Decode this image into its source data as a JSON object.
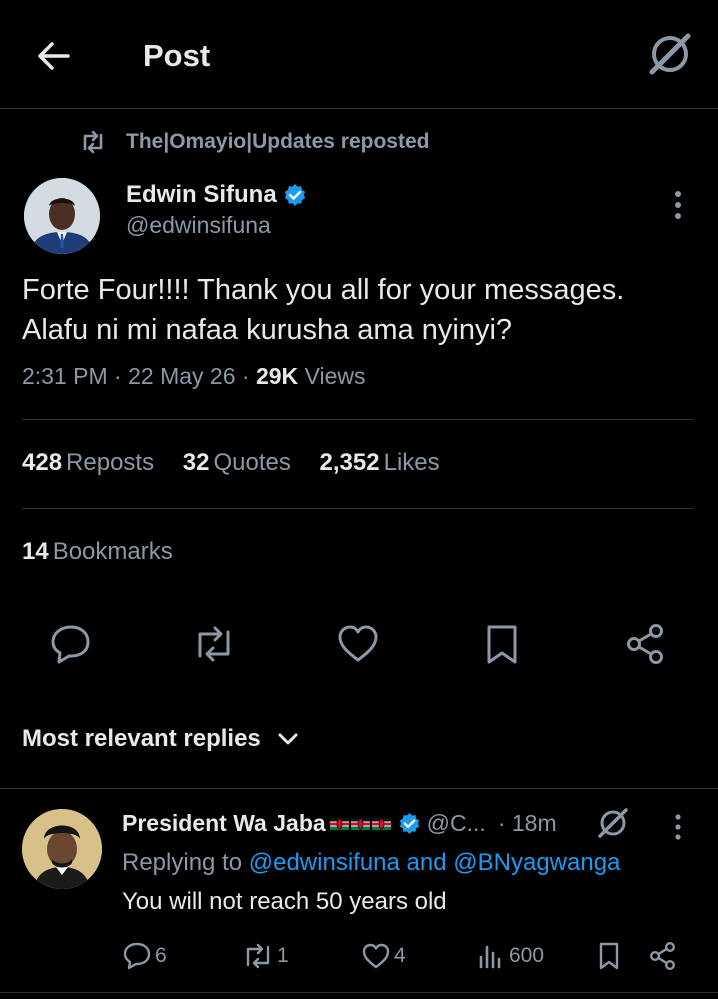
{
  "header": {
    "title": "Post"
  },
  "repost": {
    "label": "The|Omayio|Updates reposted"
  },
  "post": {
    "author_name": "Edwin Sifuna",
    "author_handle": "@edwinsifuna",
    "text_line1": "Forte Four!!!! Thank you all for your messages.",
    "text_line2": "Alafu ni mi nafaa kurusha ama nyinyi?",
    "time": "2:31 PM",
    "date": "22 May 26",
    "views_count": "29K",
    "views_label": "Views"
  },
  "stats": {
    "reposts_count": "428",
    "reposts_label": "Reposts",
    "quotes_count": "32",
    "quotes_label": "Quotes",
    "likes_count": "2,352",
    "likes_label": "Likes",
    "bookmarks_count": "14",
    "bookmarks_label": "Bookmarks"
  },
  "actions": [
    "reply-icon",
    "repost-icon",
    "like-icon",
    "bookmark-icon",
    "share-icon"
  ],
  "replies_sort": {
    "label": "Most relevant replies"
  },
  "reply": {
    "name": "President Wa Jaba",
    "handle": "@C...",
    "time": "· 18m",
    "replying_prefix": "Replying to",
    "mention1": "@edwinsifuna",
    "and": "and",
    "mention2": "@BNyagwanga",
    "text": "You will not reach 50 years old",
    "reply_count": "6",
    "repost_count": "1",
    "like_count": "4",
    "views_count": "600"
  },
  "colors": {
    "background": "#000000",
    "text": "#e7e9ea",
    "muted": "#8b98a5",
    "accent": "#1d9bf0",
    "divider": "#2f3336"
  }
}
